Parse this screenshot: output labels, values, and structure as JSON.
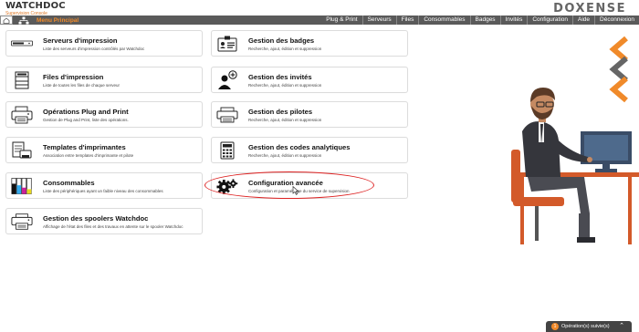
{
  "app": {
    "logo_text": "WATCHDOC",
    "logo_subtitle": "Supervision Console",
    "brand": "DOXENSE"
  },
  "nav": {
    "menu_principal": "Menu Principal",
    "links": [
      "Plug & Print",
      "Serveurs",
      "Files",
      "Consommables",
      "Badges",
      "Invités",
      "Configuration",
      "Aide",
      "Déconnexion"
    ]
  },
  "tiles": [
    {
      "title": "Serveurs d'impression",
      "desc": "Liste des serveurs d'impression contrôlés par Watchdoc",
      "icon": "server-icon"
    },
    {
      "title": "Gestion des badges",
      "desc": "Recherche, ajout, édition et suppression",
      "icon": "badge-icon"
    },
    {
      "title": "Files d'impression",
      "desc": "Liste de toutes les files de chaque serveur",
      "icon": "printer-queue-icon"
    },
    {
      "title": "Gestion des invités",
      "desc": "Recherche, ajout, édition et suppression",
      "icon": "add-guest-icon"
    },
    {
      "title": "Opérations Plug and Print",
      "desc": "Gestion de Plug and Print, liste des opérations.",
      "icon": "plug-print-icon"
    },
    {
      "title": "Gestion des pilotes",
      "desc": "Recherche, ajout, édition et suppression",
      "icon": "driver-icon"
    },
    {
      "title": "Templates d'imprimantes",
      "desc": "Association entre templates d'imprimante et pilote",
      "icon": "template-icon"
    },
    {
      "title": "Gestion des codes analytiques",
      "desc": "Recherche, ajout, édition et suppression",
      "icon": "calculator-icon"
    },
    {
      "title": "Consommables",
      "desc": "Liste des périphériques ayant un faible niveau des consommables",
      "icon": "toner-icon"
    },
    {
      "title": "Configuration avancée",
      "desc": "Configuration et paramétrage du service de supervision",
      "icon": "gears-icon"
    },
    {
      "title": "Gestion des spoolers Watchdoc",
      "desc": "Affichage de l'état des files et des travaux en attente sur le spooler Watchdoc",
      "icon": "spooler-icon"
    }
  ],
  "status": {
    "count": "1",
    "label": "Opération(s) suivie(s)"
  },
  "colors": {
    "accent": "#f08a2a",
    "navbar": "#5a5a5a",
    "highlight": "#d22222"
  }
}
